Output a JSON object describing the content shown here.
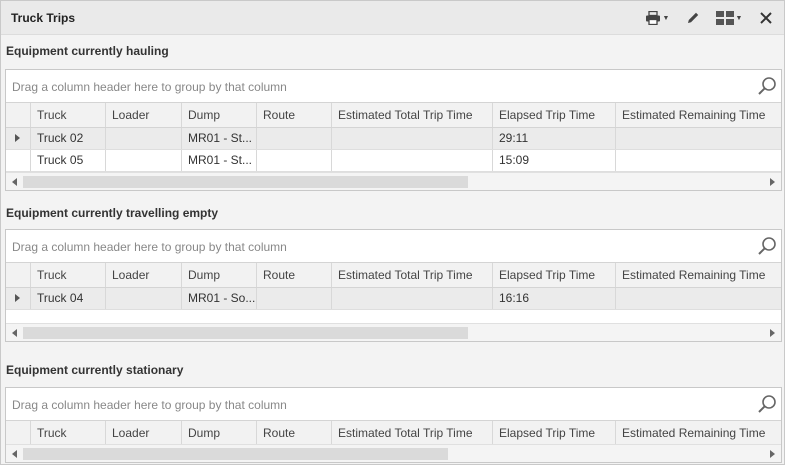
{
  "window": {
    "title": "Truck Trips"
  },
  "toolbar": [
    {
      "icon": "printer-icon"
    },
    {
      "icon": "pencil-icon"
    },
    {
      "icon": "layout-grid-icon"
    },
    {
      "icon": "close-icon"
    }
  ],
  "columns": [
    "Truck",
    "Loader",
    "Dump",
    "Route",
    "Estimated Total Trip Time",
    "Elapsed Trip Time",
    "Estimated Remaining Time"
  ],
  "group_hint": "Drag a column header here to group by that column",
  "sections": [
    {
      "label": "Equipment currently hauling",
      "rows": [
        {
          "truck": "Truck 02",
          "loader": "",
          "dump": "MR01 - St...",
          "route": "",
          "est_total": "",
          "elapsed": "29:11",
          "est_remaining": ""
        },
        {
          "truck": "Truck 05",
          "loader": "",
          "dump": "MR01 - St...",
          "route": "",
          "est_total": "",
          "elapsed": "15:09",
          "est_remaining": ""
        }
      ]
    },
    {
      "label": "Equipment currently travelling empty",
      "rows": [
        {
          "truck": "Truck 04",
          "loader": "",
          "dump": "MR01 - So...",
          "route": "",
          "est_total": "",
          "elapsed": "16:16",
          "est_remaining": ""
        }
      ]
    },
    {
      "label": "Equipment currently stationary",
      "rows": []
    }
  ]
}
